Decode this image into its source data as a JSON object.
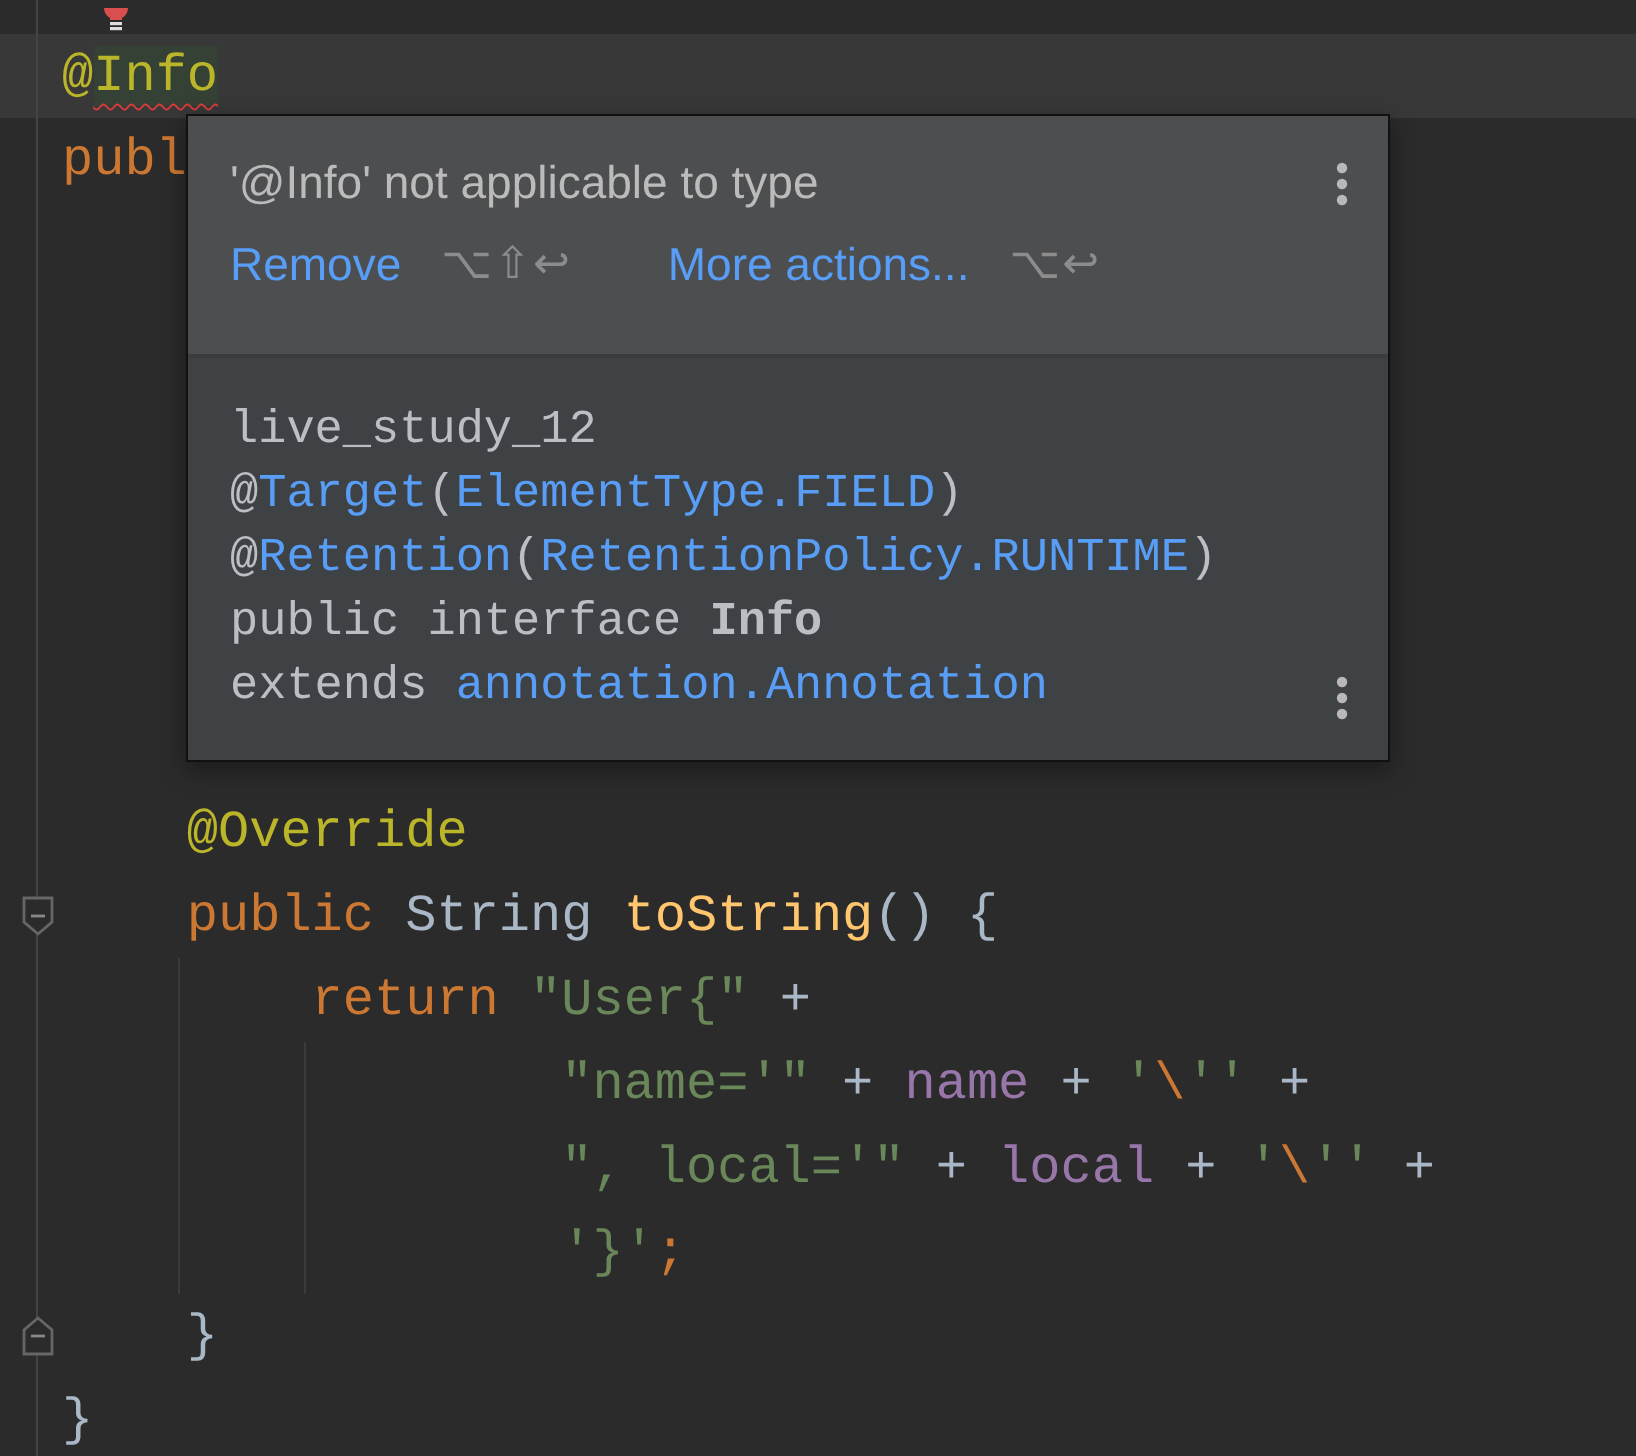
{
  "editor": {
    "lines": [
      {
        "current": true,
        "foldable": false,
        "tokens": [
          {
            "kind": "annotation",
            "text": "@"
          },
          {
            "kind": "error",
            "text": "Info"
          }
        ]
      },
      {
        "current": false,
        "foldable": false,
        "tokens": [
          {
            "kind": "keyword",
            "text": "publ"
          }
        ],
        "children": [
          {
            "current": false,
            "foldable": false,
            "tokens": [
              {
                "kind": "annotation",
                "text": "@Override"
              }
            ]
          },
          {
            "current": false,
            "foldable": true,
            "tokens": [
              {
                "kind": "keyword",
                "text": "public "
              },
              {
                "kind": "plain",
                "text": "String "
              },
              {
                "kind": "method",
                "text": "toString"
              },
              {
                "kind": "plain",
                "text": "() {"
              }
            ],
            "children": [
              {
                "current": false,
                "foldable": false,
                "tokens": [
                  {
                    "kind": "keyword",
                    "text": "return "
                  },
                  {
                    "kind": "string",
                    "text": "\"User{\""
                  },
                  {
                    "kind": "plain",
                    "text": " +"
                  }
                ],
                "children": [
                  {
                    "current": false,
                    "foldable": false,
                    "tokens": [
                      {
                        "kind": "string",
                        "text": "\"name='\""
                      },
                      {
                        "kind": "plain",
                        "text": " + "
                      },
                      {
                        "kind": "field",
                        "text": "name"
                      },
                      {
                        "kind": "plain",
                        "text": " + "
                      },
                      {
                        "kind": "string",
                        "text": "'"
                      },
                      {
                        "kind": "keyword",
                        "text": "\\"
                      },
                      {
                        "kind": "string",
                        "text": "''"
                      },
                      {
                        "kind": "plain",
                        "text": " +"
                      }
                    ]
                  },
                  {
                    "current": false,
                    "foldable": false,
                    "tokens": [
                      {
                        "kind": "string",
                        "text": "\", local='\""
                      },
                      {
                        "kind": "plain",
                        "text": " + "
                      },
                      {
                        "kind": "field",
                        "text": "local"
                      },
                      {
                        "kind": "plain",
                        "text": " + "
                      },
                      {
                        "kind": "string",
                        "text": "'"
                      },
                      {
                        "kind": "keyword",
                        "text": "\\"
                      },
                      {
                        "kind": "string",
                        "text": "''"
                      },
                      {
                        "kind": "plain",
                        "text": " +"
                      }
                    ]
                  },
                  {
                    "current": false,
                    "foldable": false,
                    "tokens": [
                      {
                        "kind": "string",
                        "text": "'}'"
                      },
                      {
                        "kind": "keyword",
                        "text": ";"
                      }
                    ]
                  }
                ]
              }
            ],
            "closing": {
              "tokens": [
                {
                  "kind": "plain",
                  "text": "}"
                }
              ]
            }
          }
        ],
        "closing": {
          "tokens": [
            {
              "kind": "plain",
              "text": "}"
            }
          ]
        }
      }
    ]
  },
  "popup": {
    "title": "'@Info' not applicable to type",
    "actions": [
      {
        "label": "Remove",
        "shortcut": "⌥⇧↩"
      },
      {
        "label": "More actions...",
        "shortcut": "⌥↩"
      }
    ],
    "doc": [
      [
        {
          "kind": "plain",
          "text": "live_study_12"
        }
      ],
      [
        {
          "kind": "plain",
          "text": "@"
        },
        {
          "kind": "link",
          "text": "Target"
        },
        {
          "kind": "plain",
          "text": "("
        },
        {
          "kind": "link",
          "text": "ElementType.FIELD"
        },
        {
          "kind": "plain",
          "text": ")"
        }
      ],
      [
        {
          "kind": "plain",
          "text": "@"
        },
        {
          "kind": "link",
          "text": "Retention"
        },
        {
          "kind": "plain",
          "text": "("
        },
        {
          "kind": "link",
          "text": "RetentionPolicy.RUNTIME"
        },
        {
          "kind": "plain",
          "text": ")"
        }
      ],
      [
        {
          "kind": "plain",
          "text": "public interface "
        },
        {
          "kind": "bold",
          "text": "Info"
        }
      ],
      [
        {
          "kind": "plain",
          "text": "extends "
        },
        {
          "kind": "link",
          "text": "annotation.Annotation"
        }
      ]
    ]
  }
}
